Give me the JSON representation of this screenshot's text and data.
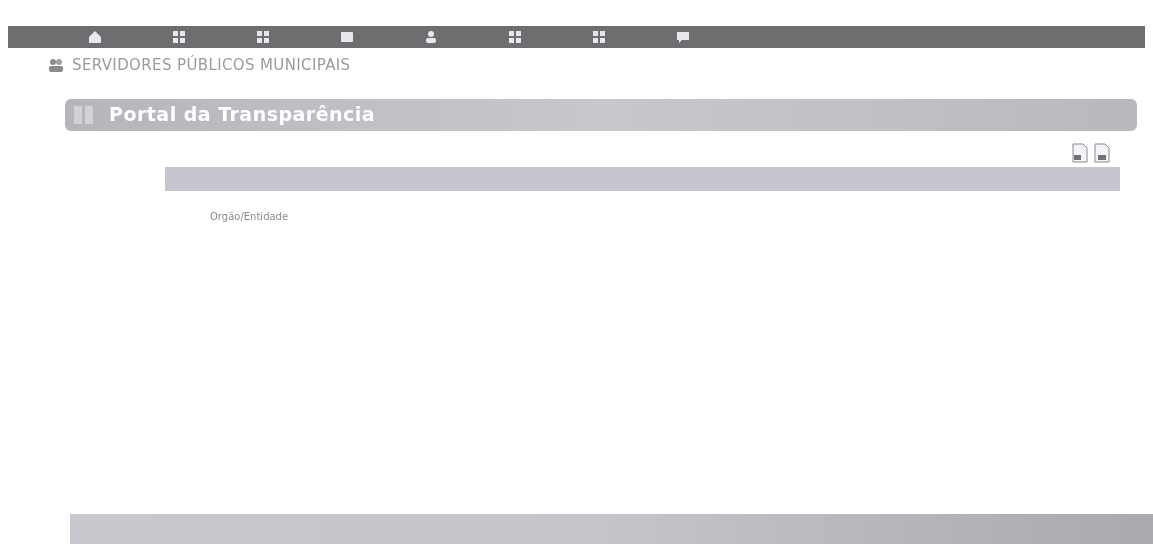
{
  "nav": {
    "items": [
      {
        "kind": "home"
      },
      {
        "kind": "grid"
      },
      {
        "kind": "grid"
      },
      {
        "kind": "card"
      },
      {
        "kind": "person"
      },
      {
        "kind": "grid"
      },
      {
        "kind": "grid"
      },
      {
        "kind": "chat"
      }
    ]
  },
  "page_title": "SERVIDORES PÚBLICOS MUNICIPAIS",
  "banner": {
    "title": "Portal da Transparência"
  },
  "table": {
    "columns": [
      "Orgão/Entidade"
    ]
  }
}
